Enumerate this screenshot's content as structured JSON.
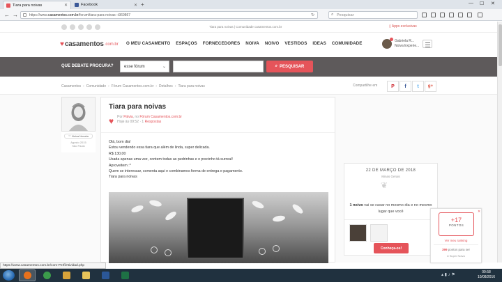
{
  "browser": {
    "tabs": [
      {
        "title": "Tiara para noivas",
        "active": true,
        "icon_color": "#e5545a"
      },
      {
        "title": "Facebook",
        "active": false,
        "icon_color": "#3b5998"
      }
    ],
    "new_tab_symbol": "+",
    "url_prefix": "https://www.",
    "url_host": "casamentos.com.br",
    "url_path": "/forum/tiara-para-noivas--t369867",
    "search_placeholder": "Pesquisar",
    "window_controls": {
      "minimize": "—",
      "maximize": "☐",
      "close": "✕"
    }
  },
  "topstrip": {
    "links_text": "Tiara para noivas | Comunidade casamentos.com.br",
    "apps_link": "Apps exclusivas"
  },
  "site": {
    "logo_text": "casamentos",
    "logo_tld": ".com.br",
    "menu": [
      "O MEU CASAMENTO",
      "ESPAÇOS",
      "FORNECEDORES",
      "NOIVA",
      "NOIVO",
      "VESTIDOS",
      "IDEAS",
      "COMUNIDADE"
    ],
    "user": {
      "name": "Gabriela R...",
      "subtitle": "Noiva Experie..."
    }
  },
  "debate": {
    "label": "QUE DEBATE PROCURA?",
    "select_value": "esse fórum",
    "button_label": "PESQUISAR"
  },
  "breadcrumb": [
    "Casamentos",
    "Comunidade",
    "Fórum Casamentos.com.br",
    "Detalhes",
    "Tiara para noivas"
  ],
  "share": {
    "label": "Compartilhe em",
    "buttons": [
      {
        "name": "pinterest",
        "glyph": "P",
        "color": "#cb2027"
      },
      {
        "name": "facebook",
        "glyph": "f",
        "color": "#3b5998"
      },
      {
        "name": "twitter",
        "glyph": "t",
        "color": "#55acee"
      },
      {
        "name": "googleplus",
        "glyph": "g+",
        "color": "#dd4b39"
      }
    ]
  },
  "author": {
    "badge": "Noiva Novata",
    "date_line1": "Agosto 2015",
    "date_line2": "São Paulo"
  },
  "post": {
    "title": "Tiara para noivas",
    "meta_by": "Por",
    "author": "Flávia",
    "meta_in": ", no",
    "forum": "Fórum Casamentos.com.br",
    "meta_time": "Hoje às 09:52 · 1",
    "replies": "Respostas",
    "body": [
      "Olá, bom dia!",
      "Estou vendendo essa tiara que além de linda, super delicada.",
      "R$ 130,00",
      "Usada apenas uma vez, contem todas as pedrinhas e o precinho tá surreal!",
      "Aproveitem :*",
      "Quem se interessar, comenta aqui e combinamos forma de entrega e pagamento.",
      "Tiara para noivas"
    ]
  },
  "datecard": {
    "date": "22 DE MARÇO DE 2018",
    "location": "Minas Gerais",
    "msg_bold": "1 noivo",
    "msg_rest": " vai se casar no mesmo dia e no mesmo lugar que você",
    "button_label": "Conheça-os!"
  },
  "points": {
    "close": "✕",
    "value": "+17",
    "label": "PONTOS",
    "rank_link": "Ver meu ranking",
    "pts_bold": "399",
    "pts_rest": " pontos para ser",
    "level": "Super Noiva"
  },
  "status_url": "https://www.casamentos.com.br/com-PerfilAtividad.php",
  "taskbar": {
    "apps": [
      {
        "name": "firefox",
        "color": "#e8711c",
        "active": true
      },
      {
        "name": "chrome",
        "color": "#3b9b4b",
        "active": false
      },
      {
        "name": "outlook",
        "color": "#d8a33a",
        "active": false
      },
      {
        "name": "explorer",
        "color": "#e8c45a",
        "active": false
      },
      {
        "name": "word",
        "color": "#2b5797",
        "active": false
      },
      {
        "name": "excel",
        "color": "#1e7145",
        "active": false
      }
    ],
    "clock_time": "09:58",
    "clock_date": "10/08/2016"
  },
  "colors": {
    "accent": "#e5545a",
    "debate_bar": "#5e5a5b"
  }
}
